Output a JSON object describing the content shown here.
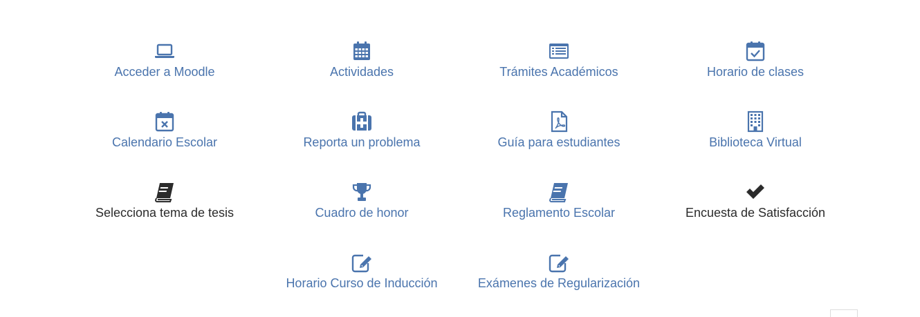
{
  "tiles": [
    {
      "label": "Acceder a Moodle",
      "icon": "laptop-icon",
      "color": "#4a74ad"
    },
    {
      "label": "Actividades",
      "icon": "calendar-grid-icon",
      "color": "#4a74ad"
    },
    {
      "label": "Trámites Académicos",
      "icon": "list-alt-icon",
      "color": "#4a74ad"
    },
    {
      "label": "Horario de clases",
      "icon": "calendar-check-icon",
      "color": "#4a74ad"
    },
    {
      "label": "Calendario Escolar",
      "icon": "calendar-x-icon",
      "color": "#4a74ad"
    },
    {
      "label": "Reporta un problema",
      "icon": "medkit-icon",
      "color": "#4a74ad"
    },
    {
      "label": "Guía para estudiantes",
      "icon": "file-pdf-icon",
      "color": "#4a74ad"
    },
    {
      "label": "Biblioteca Virtual",
      "icon": "building-icon",
      "color": "#4a74ad"
    },
    {
      "label": "Selecciona tema de tesis",
      "icon": "book-icon",
      "color": "#2b2b2b"
    },
    {
      "label": "Cuadro de honor",
      "icon": "trophy-icon",
      "color": "#4a74ad"
    },
    {
      "label": "Reglamento Escolar",
      "icon": "book-icon",
      "color": "#4a74ad"
    },
    {
      "label": "Encuesta de Satisfacción",
      "icon": "check-icon",
      "color": "#2b2b2b"
    },
    {
      "label": "Horario Curso de Inducción",
      "icon": "edit-icon",
      "color": "#4a74ad"
    },
    {
      "label": "Exámenes de Regularización",
      "icon": "edit-icon",
      "color": "#4a74ad"
    }
  ]
}
